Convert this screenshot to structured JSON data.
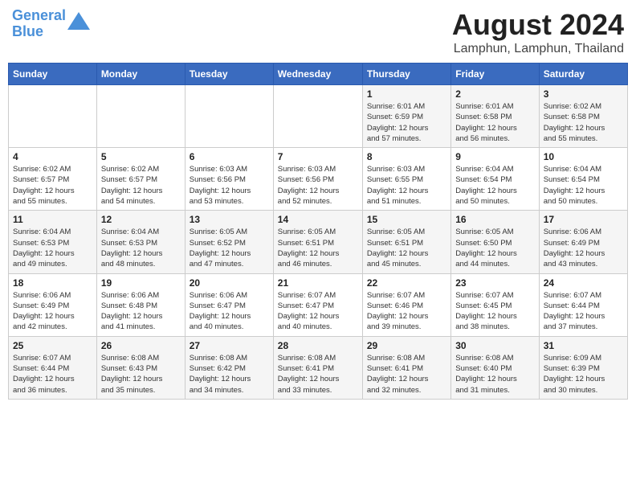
{
  "header": {
    "logo_line1": "General",
    "logo_line2": "Blue",
    "main_title": "August 2024",
    "subtitle": "Lamphun, Lamphun, Thailand"
  },
  "days_of_week": [
    "Sunday",
    "Monday",
    "Tuesday",
    "Wednesday",
    "Thursday",
    "Friday",
    "Saturday"
  ],
  "weeks": [
    [
      {
        "num": "",
        "info": ""
      },
      {
        "num": "",
        "info": ""
      },
      {
        "num": "",
        "info": ""
      },
      {
        "num": "",
        "info": ""
      },
      {
        "num": "1",
        "info": "Sunrise: 6:01 AM\nSunset: 6:59 PM\nDaylight: 12 hours\nand 57 minutes."
      },
      {
        "num": "2",
        "info": "Sunrise: 6:01 AM\nSunset: 6:58 PM\nDaylight: 12 hours\nand 56 minutes."
      },
      {
        "num": "3",
        "info": "Sunrise: 6:02 AM\nSunset: 6:58 PM\nDaylight: 12 hours\nand 55 minutes."
      }
    ],
    [
      {
        "num": "4",
        "info": "Sunrise: 6:02 AM\nSunset: 6:57 PM\nDaylight: 12 hours\nand 55 minutes."
      },
      {
        "num": "5",
        "info": "Sunrise: 6:02 AM\nSunset: 6:57 PM\nDaylight: 12 hours\nand 54 minutes."
      },
      {
        "num": "6",
        "info": "Sunrise: 6:03 AM\nSunset: 6:56 PM\nDaylight: 12 hours\nand 53 minutes."
      },
      {
        "num": "7",
        "info": "Sunrise: 6:03 AM\nSunset: 6:56 PM\nDaylight: 12 hours\nand 52 minutes."
      },
      {
        "num": "8",
        "info": "Sunrise: 6:03 AM\nSunset: 6:55 PM\nDaylight: 12 hours\nand 51 minutes."
      },
      {
        "num": "9",
        "info": "Sunrise: 6:04 AM\nSunset: 6:54 PM\nDaylight: 12 hours\nand 50 minutes."
      },
      {
        "num": "10",
        "info": "Sunrise: 6:04 AM\nSunset: 6:54 PM\nDaylight: 12 hours\nand 50 minutes."
      }
    ],
    [
      {
        "num": "11",
        "info": "Sunrise: 6:04 AM\nSunset: 6:53 PM\nDaylight: 12 hours\nand 49 minutes."
      },
      {
        "num": "12",
        "info": "Sunrise: 6:04 AM\nSunset: 6:53 PM\nDaylight: 12 hours\nand 48 minutes."
      },
      {
        "num": "13",
        "info": "Sunrise: 6:05 AM\nSunset: 6:52 PM\nDaylight: 12 hours\nand 47 minutes."
      },
      {
        "num": "14",
        "info": "Sunrise: 6:05 AM\nSunset: 6:51 PM\nDaylight: 12 hours\nand 46 minutes."
      },
      {
        "num": "15",
        "info": "Sunrise: 6:05 AM\nSunset: 6:51 PM\nDaylight: 12 hours\nand 45 minutes."
      },
      {
        "num": "16",
        "info": "Sunrise: 6:05 AM\nSunset: 6:50 PM\nDaylight: 12 hours\nand 44 minutes."
      },
      {
        "num": "17",
        "info": "Sunrise: 6:06 AM\nSunset: 6:49 PM\nDaylight: 12 hours\nand 43 minutes."
      }
    ],
    [
      {
        "num": "18",
        "info": "Sunrise: 6:06 AM\nSunset: 6:49 PM\nDaylight: 12 hours\nand 42 minutes."
      },
      {
        "num": "19",
        "info": "Sunrise: 6:06 AM\nSunset: 6:48 PM\nDaylight: 12 hours\nand 41 minutes."
      },
      {
        "num": "20",
        "info": "Sunrise: 6:06 AM\nSunset: 6:47 PM\nDaylight: 12 hours\nand 40 minutes."
      },
      {
        "num": "21",
        "info": "Sunrise: 6:07 AM\nSunset: 6:47 PM\nDaylight: 12 hours\nand 40 minutes."
      },
      {
        "num": "22",
        "info": "Sunrise: 6:07 AM\nSunset: 6:46 PM\nDaylight: 12 hours\nand 39 minutes."
      },
      {
        "num": "23",
        "info": "Sunrise: 6:07 AM\nSunset: 6:45 PM\nDaylight: 12 hours\nand 38 minutes."
      },
      {
        "num": "24",
        "info": "Sunrise: 6:07 AM\nSunset: 6:44 PM\nDaylight: 12 hours\nand 37 minutes."
      }
    ],
    [
      {
        "num": "25",
        "info": "Sunrise: 6:07 AM\nSunset: 6:44 PM\nDaylight: 12 hours\nand 36 minutes."
      },
      {
        "num": "26",
        "info": "Sunrise: 6:08 AM\nSunset: 6:43 PM\nDaylight: 12 hours\nand 35 minutes."
      },
      {
        "num": "27",
        "info": "Sunrise: 6:08 AM\nSunset: 6:42 PM\nDaylight: 12 hours\nand 34 minutes."
      },
      {
        "num": "28",
        "info": "Sunrise: 6:08 AM\nSunset: 6:41 PM\nDaylight: 12 hours\nand 33 minutes."
      },
      {
        "num": "29",
        "info": "Sunrise: 6:08 AM\nSunset: 6:41 PM\nDaylight: 12 hours\nand 32 minutes."
      },
      {
        "num": "30",
        "info": "Sunrise: 6:08 AM\nSunset: 6:40 PM\nDaylight: 12 hours\nand 31 minutes."
      },
      {
        "num": "31",
        "info": "Sunrise: 6:09 AM\nSunset: 6:39 PM\nDaylight: 12 hours\nand 30 minutes."
      }
    ]
  ]
}
